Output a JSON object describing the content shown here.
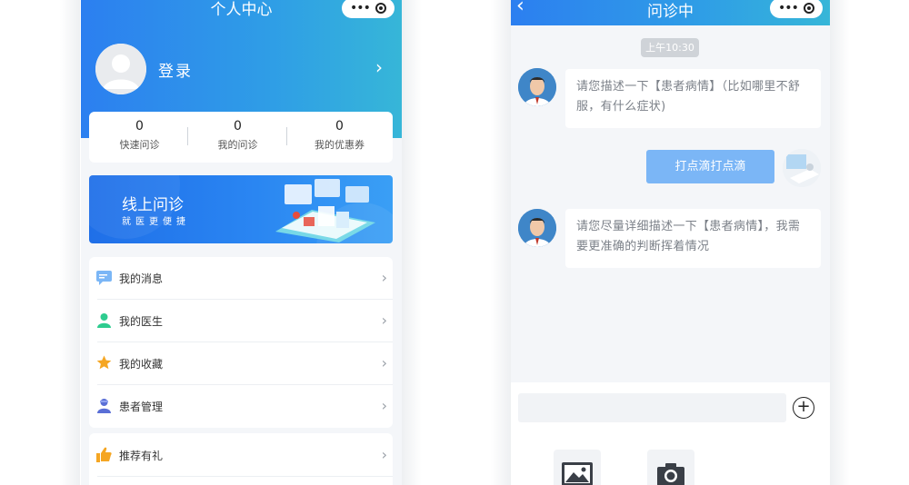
{
  "left_screen": {
    "nav_title": "个人中心",
    "login_label": "登录",
    "stats": [
      {
        "value": "0",
        "label": "快速问诊"
      },
      {
        "value": "0",
        "label": "我的问诊"
      },
      {
        "value": "0",
        "label": "我的优惠券"
      }
    ],
    "banner": {
      "title": "线上问诊",
      "subtitle": "就医更便捷"
    },
    "menu_group1": [
      {
        "label": "我的消息",
        "icon": "message-icon"
      },
      {
        "label": "我的医生",
        "icon": "doctor-icon"
      },
      {
        "label": "我的收藏",
        "icon": "star-icon"
      },
      {
        "label": "患者管理",
        "icon": "patient-icon"
      }
    ],
    "menu_group2": [
      {
        "label": "推荐有礼",
        "icon": "thumbs-up-icon"
      }
    ],
    "colors": {
      "header_start": "#2c7ff0",
      "header_end": "#36b6d8",
      "accent": "#2a86f2"
    }
  },
  "right_screen": {
    "nav_title": "问诊中",
    "time_label": "上午10:30",
    "messages": [
      {
        "from": "doctor",
        "text": "请您描述一下【患者病情】（比如哪里不舒服，有什么症状)"
      },
      {
        "from": "user",
        "text": "打点滴打点滴"
      },
      {
        "from": "doctor",
        "text": "请您尽量详细描述一下【患者病情】，我需要更准确的判断挥着情况"
      }
    ],
    "input_placeholder": "",
    "tools": [
      {
        "icon": "image-icon"
      },
      {
        "icon": "camera-icon"
      }
    ]
  }
}
